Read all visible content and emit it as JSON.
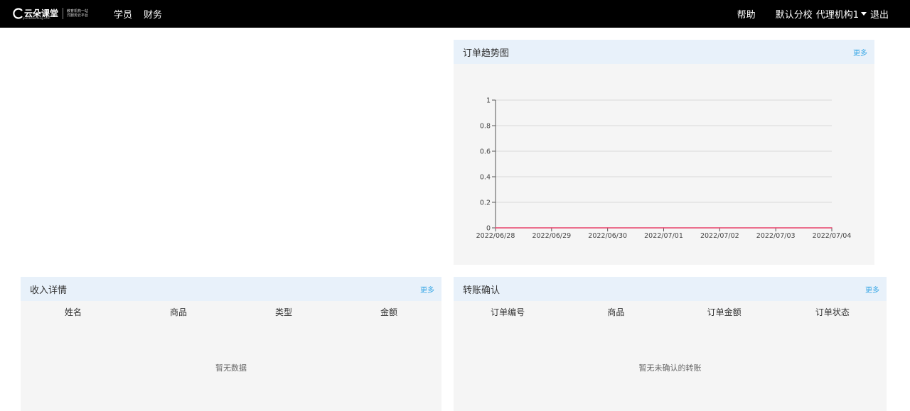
{
  "header": {
    "logo_text": "云朵课堂",
    "logo_url": "yunduoketang.com",
    "logo_slogan_1": "教育机构一站",
    "logo_slogan_2": "式服务云平台",
    "nav": [
      {
        "label": "学员"
      },
      {
        "label": "财务"
      }
    ],
    "help": "帮助",
    "school": "默认分校",
    "org": "代理机构1",
    "logout": "退出"
  },
  "chart_panel": {
    "title": "订单趋势图",
    "more": "更多"
  },
  "chart_data": {
    "type": "line",
    "title": "",
    "xlabel": "",
    "ylabel": "",
    "categories": [
      "2022/06/28",
      "2022/06/29",
      "2022/06/30",
      "2022/07/01",
      "2022/07/02",
      "2022/07/03",
      "2022/07/04"
    ],
    "series": [
      {
        "values": [
          0,
          0,
          0,
          0,
          0,
          0,
          0
        ],
        "color": "#e8436b"
      }
    ],
    "yticks": [
      "0",
      "0.2",
      "0.4",
      "0.6",
      "0.8",
      "1"
    ],
    "ylim": [
      0,
      1
    ],
    "grid": true
  },
  "income_panel": {
    "title": "收入详情",
    "more": "更多",
    "columns": [
      "姓名",
      "商品",
      "类型",
      "金额"
    ],
    "empty_text": "暂无数据"
  },
  "transfer_panel": {
    "title": "转账确认",
    "more": "更多",
    "columns": [
      "订单编号",
      "商品",
      "订单金额",
      "订单状态"
    ],
    "empty_text": "暂无未确认的转账"
  }
}
